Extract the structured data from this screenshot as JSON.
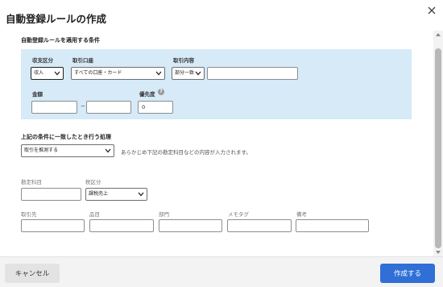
{
  "dialog": {
    "title": "自動登録ルールの作成",
    "close_icon": "close-icon"
  },
  "conditions": {
    "heading": "自動登録ルールを適用する条件",
    "income_expense": {
      "label": "収支区分",
      "value": "収入"
    },
    "account": {
      "label": "取引口座",
      "value": "すべての口座・カード"
    },
    "content": {
      "label": "取引内容",
      "match_value": "部分一致",
      "text_value": ""
    },
    "amount": {
      "label": "金額",
      "min_value": "",
      "max_value": "",
      "separator": "~"
    },
    "priority": {
      "label": "優先度",
      "value": "0",
      "help_icon": "?"
    }
  },
  "processing": {
    "heading": "上記の条件に一致したとき行う処理",
    "action": {
      "value": "取引を推測する"
    },
    "note": "あらかじめ下記の勘定科目などの内容が入力されます。"
  },
  "fields": {
    "account_item": {
      "label": "勘定科目",
      "value": ""
    },
    "tax_category": {
      "label": "税区分",
      "value": "課税売上"
    },
    "partner": {
      "label": "取引先",
      "value": ""
    },
    "item": {
      "label": "品目",
      "value": ""
    },
    "department": {
      "label": "部門",
      "value": ""
    },
    "memo_tag": {
      "label": "メモタグ",
      "value": ""
    },
    "remarks": {
      "label": "備考",
      "value": ""
    }
  },
  "footer": {
    "cancel_label": "キャンセル",
    "create_label": "作成する"
  },
  "colors": {
    "condition_bg": "#d6eaf8",
    "primary": "#2f6fd6",
    "footer_bg": "#f3f3f3"
  }
}
